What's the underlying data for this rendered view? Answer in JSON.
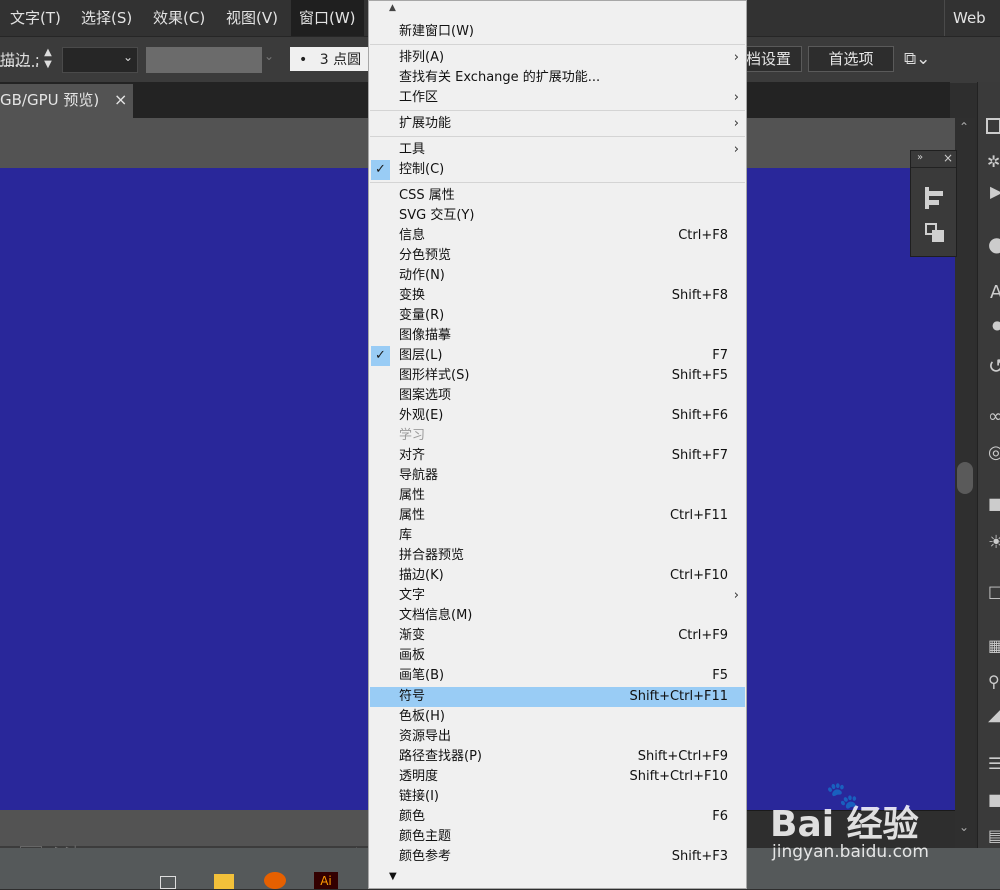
{
  "menubar": {
    "items": [
      "文字(T)",
      "选择(S)",
      "效果(C)",
      "视图(V)",
      "窗口(W)"
    ],
    "workspace": "Web"
  },
  "controlbar": {
    "stroke_label": "描边 :",
    "stroke_brush": "3 点圆",
    "doc_settings": "文档设置",
    "preferences": "首选项"
  },
  "document_tab": {
    "title": "GB/GPU 预览)",
    "close": "×"
  },
  "statusbar": {
    "tool": "选择"
  },
  "watermark": {
    "logo": "Bai 经验",
    "url": "jingyan.baidu.com"
  },
  "menu": {
    "items": [
      {
        "label": "新建窗口(W)"
      },
      {
        "label": "排列(A)"
      },
      {
        "label": "查找有关 Exchange 的扩展功能..."
      },
      {
        "label": "工作区"
      },
      {
        "label": "扩展功能"
      },
      {
        "label": "工具"
      },
      {
        "label": "控制(C)"
      },
      {
        "label": "CSS 属性"
      },
      {
        "label": "SVG 交互(Y)"
      },
      {
        "label": "信息",
        "shortcut": "Ctrl+F8"
      },
      {
        "label": "分色预览"
      },
      {
        "label": "动作(N)"
      },
      {
        "label": "变换",
        "shortcut": "Shift+F8"
      },
      {
        "label": "变量(R)"
      },
      {
        "label": "图像描摹"
      },
      {
        "label": "图层(L)",
        "shortcut": "F7"
      },
      {
        "label": "图形样式(S)",
        "shortcut": "Shift+F5"
      },
      {
        "label": "图案选项"
      },
      {
        "label": "外观(E)",
        "shortcut": "Shift+F6"
      },
      {
        "label": "学习"
      },
      {
        "label": "对齐",
        "shortcut": "Shift+F7"
      },
      {
        "label": "导航器"
      },
      {
        "label": "属性"
      },
      {
        "label": "属性",
        "shortcut": "Ctrl+F11"
      },
      {
        "label": "库"
      },
      {
        "label": "拼合器预览"
      },
      {
        "label": "描边(K)",
        "shortcut": "Ctrl+F10"
      },
      {
        "label": "文字"
      },
      {
        "label": "文档信息(M)"
      },
      {
        "label": "渐变",
        "shortcut": "Ctrl+F9"
      },
      {
        "label": "画板"
      },
      {
        "label": "画笔(B)",
        "shortcut": "F5"
      },
      {
        "label": "符号",
        "shortcut": "Shift+Ctrl+F11"
      },
      {
        "label": "色板(H)"
      },
      {
        "label": "资源导出"
      },
      {
        "label": "路径查找器(P)",
        "shortcut": "Shift+Ctrl+F9"
      },
      {
        "label": "透明度",
        "shortcut": "Shift+Ctrl+F10"
      },
      {
        "label": "链接(I)"
      },
      {
        "label": "颜色",
        "shortcut": "F6"
      },
      {
        "label": "颜色主题"
      },
      {
        "label": "颜色参考",
        "shortcut": "Shift+F3"
      }
    ]
  },
  "colors": {
    "canvas": "#29279a",
    "highlight": "#99ccf5"
  }
}
